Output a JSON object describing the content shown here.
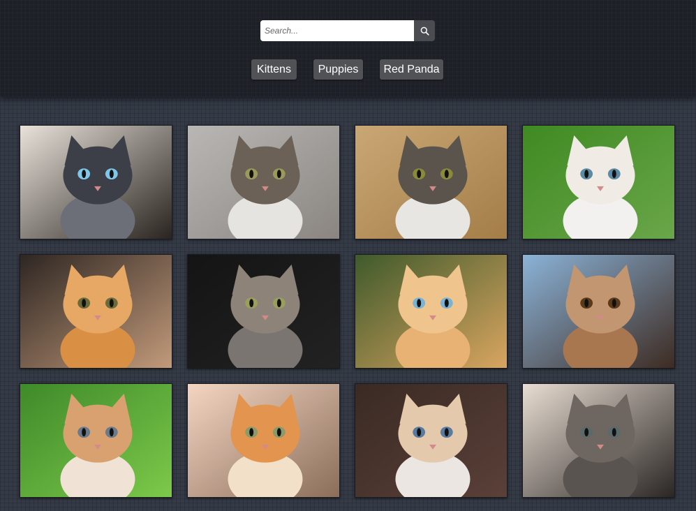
{
  "search": {
    "placeholder": "Search...",
    "button_icon": "search-icon"
  },
  "categories": [
    {
      "label": "Kittens"
    },
    {
      "label": "Puppies"
    },
    {
      "label": "Red Panda"
    }
  ],
  "gallery": {
    "images": [
      {
        "subject": "siamese-kitten",
        "bg": "#e8e2da",
        "bg2": "#2a2420",
        "fur": "#6c6e78",
        "face": "#3c3f48",
        "eyes": "#7fc6ea"
      },
      {
        "subject": "white-tabby-kitten",
        "bg": "#b9b7b4",
        "bg2": "#8a8581",
        "fur": "#e6e4e1",
        "face": "#6b6156",
        "eyes": "#9b9a5a"
      },
      {
        "subject": "grey-white-kitten",
        "bg": "#c9a774",
        "bg2": "#a47d48",
        "fur": "#e8e6e3",
        "face": "#5a544c",
        "eyes": "#8a8a3a"
      },
      {
        "subject": "white-kitten",
        "bg": "#3f8a22",
        "bg2": "#6aa64a",
        "fur": "#f3f1ef",
        "face": "#f0ebe4",
        "eyes": "#5c8ba4"
      },
      {
        "subject": "orange-kitten",
        "bg": "#2e2622",
        "bg2": "#c29a7a",
        "fur": "#d98f44",
        "face": "#e7a865",
        "eyes": "#6b6a3a"
      },
      {
        "subject": "tabby-kitten-dark",
        "bg": "#141414",
        "bg2": "#222222",
        "fur": "#7a7570",
        "face": "#8d8378",
        "eyes": "#9aa05a"
      },
      {
        "subject": "orange-kitten-grass",
        "bg": "#3f5a2b",
        "bg2": "#d9a560",
        "fur": "#e7b273",
        "face": "#efc48d",
        "eyes": "#7bb3d5"
      },
      {
        "subject": "tabby-kitten-blue",
        "bg": "#8bb3d8",
        "bg2": "#3d2b22",
        "fur": "#a8764f",
        "face": "#c29670",
        "eyes": "#5a3a1a"
      },
      {
        "subject": "kitten-on-grass",
        "bg": "#3f8a2a",
        "bg2": "#7cc94a",
        "fur": "#f0e2d4",
        "face": "#d9a070",
        "eyes": "#6a7a8a"
      },
      {
        "subject": "orange-white-kitten",
        "bg": "#f3d5c2",
        "bg2": "#8a6e5a",
        "fur": "#f2e0c8",
        "face": "#e3944f",
        "eyes": "#8a9a6a"
      },
      {
        "subject": "cream-kitten",
        "bg": "#3a2a24",
        "bg2": "#5a4038",
        "fur": "#ece6e2",
        "face": "#e5c9ad",
        "eyes": "#5a7aa0"
      },
      {
        "subject": "small-tabby-kitten",
        "bg": "#e8ddd2",
        "bg2": "#2a2624",
        "fur": "#5a5450",
        "face": "#6e6660",
        "eyes": "#5a6a6a"
      }
    ]
  }
}
